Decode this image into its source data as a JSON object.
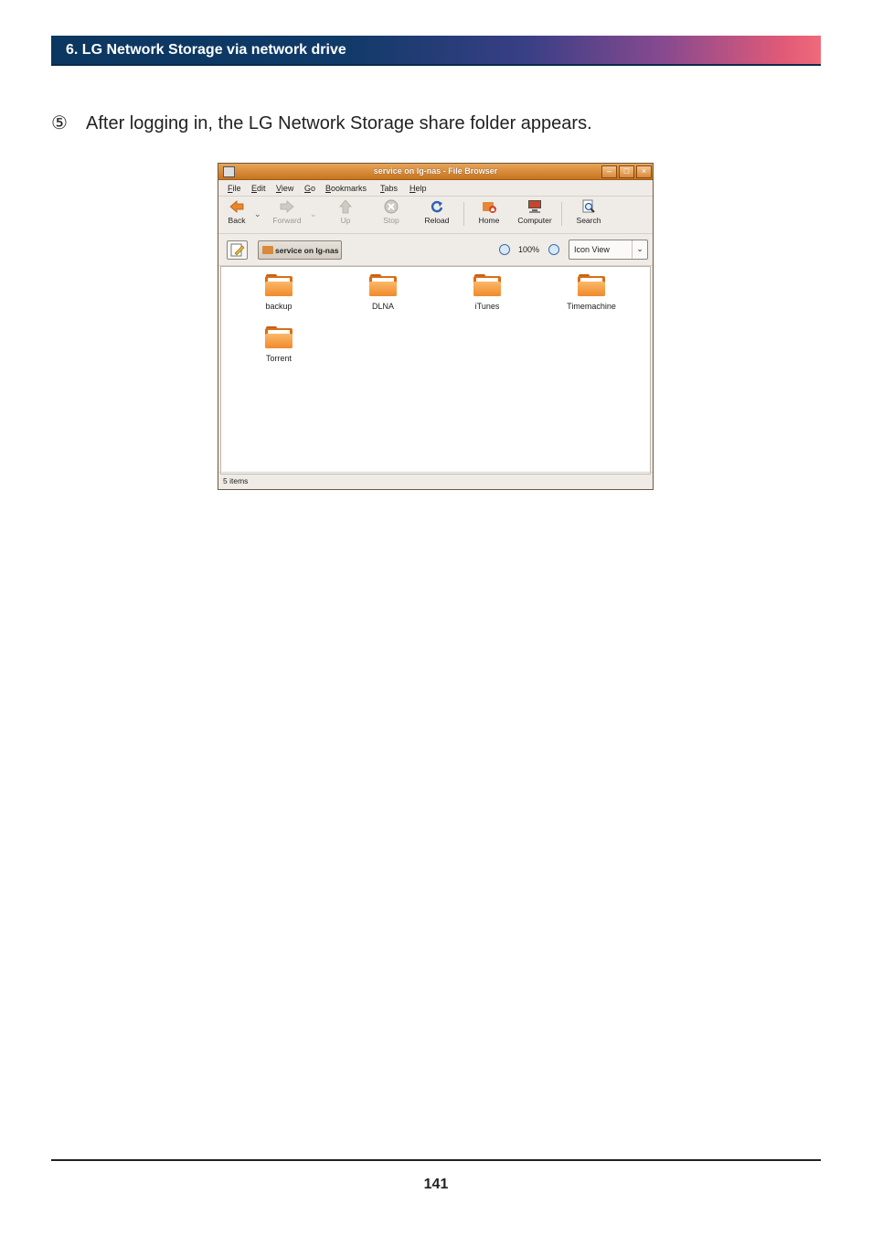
{
  "header": {
    "title": "6. LG Network Storage via network drive"
  },
  "step": {
    "number": "⑤",
    "text": "After logging in, the LG Network Storage share folder appears."
  },
  "window": {
    "title": "service on lg-nas - File Browser",
    "menu": [
      "File",
      "Edit",
      "View",
      "Go",
      "Bookmarks",
      "Tabs",
      "Help"
    ],
    "toolbar": {
      "back": "Back",
      "forward": "Forward",
      "up": "Up",
      "stop": "Stop",
      "reload": "Reload",
      "home": "Home",
      "computer": "Computer",
      "search": "Search"
    },
    "location": {
      "crumb": "service on lg-nas",
      "zoom": "100%",
      "view": "Icon View"
    },
    "files": [
      "backup",
      "DLNA",
      "iTunes",
      "Timemachine",
      "Torrent"
    ],
    "status": "5 items"
  },
  "page_number": "141"
}
